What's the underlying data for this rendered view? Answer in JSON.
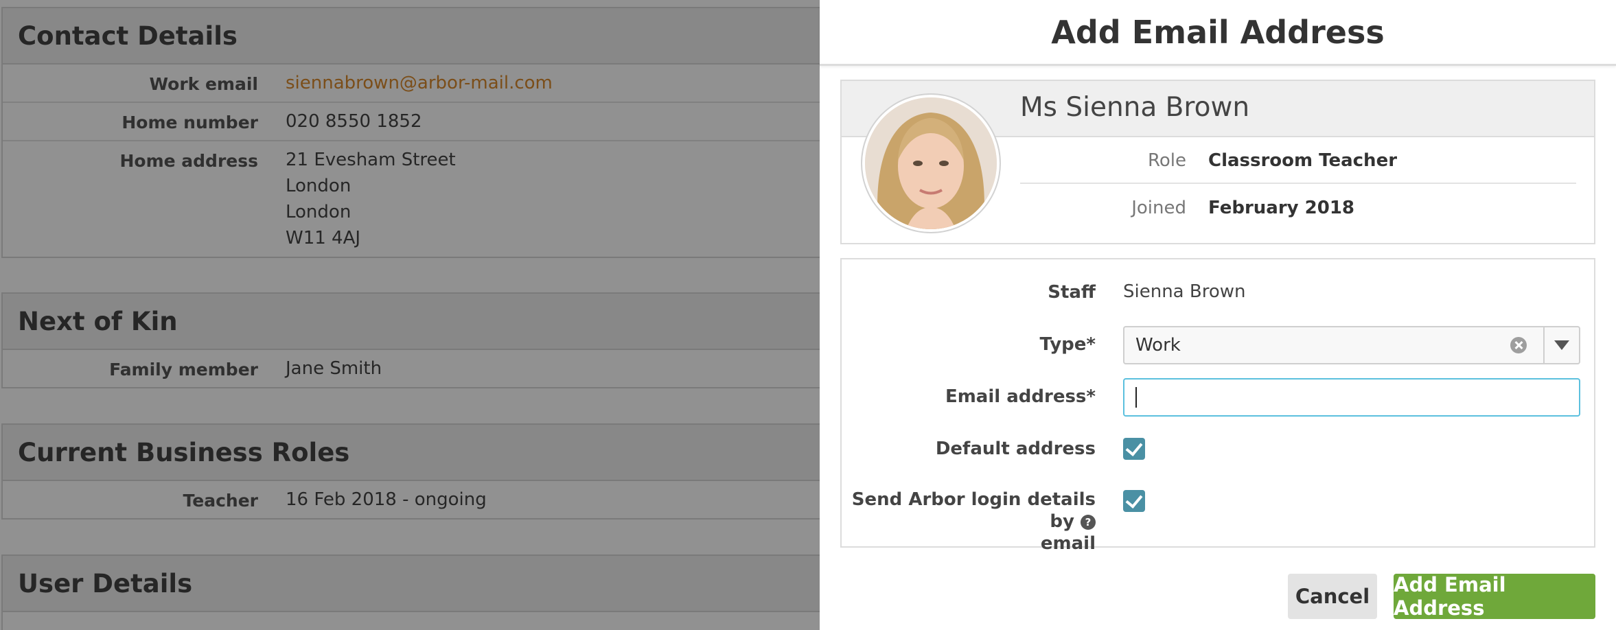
{
  "background": {
    "sections": [
      {
        "title": "Contact Details",
        "rows": [
          {
            "label": "Work email",
            "lines": [
              "siennabrown@arbor-mail.com"
            ],
            "link": true
          },
          {
            "label": "Home number",
            "lines": [
              "020 8550 1852"
            ]
          },
          {
            "label": "Home address",
            "lines": [
              "21 Evesham Street",
              "London",
              "London",
              "W11 4AJ"
            ]
          }
        ]
      },
      {
        "title": "Next of Kin",
        "rows": [
          {
            "label": "Family member",
            "lines": [
              "Jane Smith"
            ]
          }
        ]
      },
      {
        "title": "Current Business Roles",
        "rows": [
          {
            "label": "Teacher",
            "lines": [
              "16 Feb 2018 - ongoing"
            ]
          }
        ]
      },
      {
        "title": "User Details",
        "rows": []
      }
    ]
  },
  "modal": {
    "title": "Add Email Address",
    "profile": {
      "name": "Ms Sienna Brown",
      "role_label": "Role",
      "role_value": "Classroom Teacher",
      "joined_label": "Joined",
      "joined_value": "February 2018"
    },
    "form": {
      "staff_label": "Staff",
      "staff_value": "Sienna Brown",
      "type_label": "Type*",
      "type_value": "Work",
      "email_label": "Email address*",
      "email_value": "",
      "default_label": "Default address",
      "default_checked": true,
      "send_label_line1": "Send Arbor login details by",
      "send_label_line2": "email",
      "help_glyph": "?",
      "send_checked": true
    },
    "buttons": {
      "cancel": "Cancel",
      "submit": "Add Email Address"
    }
  },
  "colors": {
    "accent_link": "#d9892d",
    "primary_button": "#6fa83a",
    "checkbox": "#4a90a4",
    "input_focus": "#5bc0de"
  }
}
